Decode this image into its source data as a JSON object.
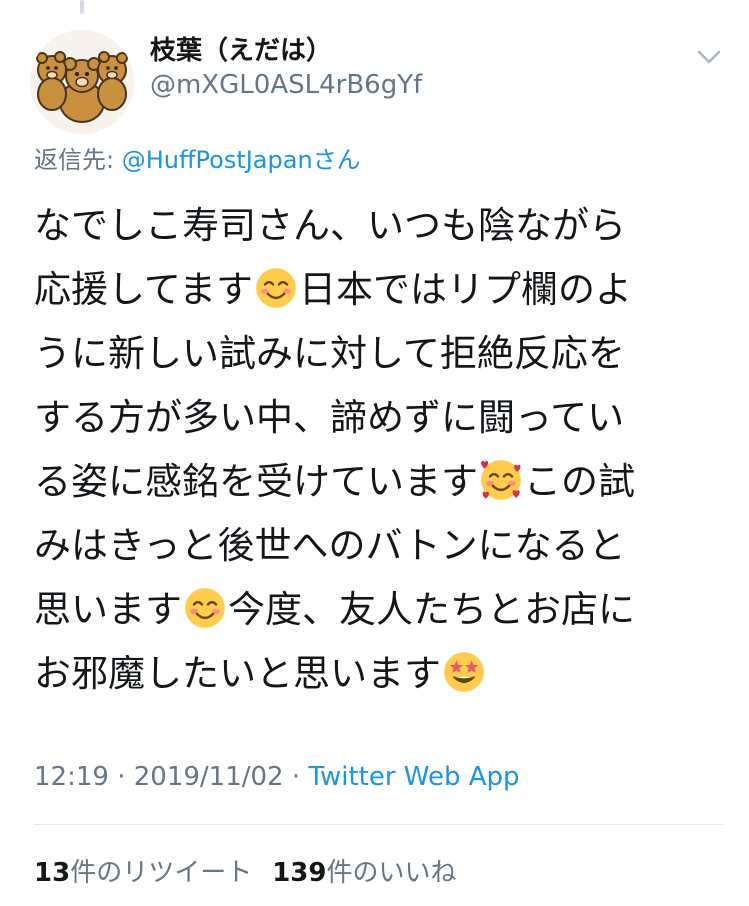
{
  "author": {
    "display_name": "枝葉（えだは）",
    "handle": "@mXGL0ASL4rB6gYf",
    "avatar_icon": "teddy-bears-avatar"
  },
  "reply": {
    "prefix": "返信先: ",
    "mention": "@HuffPostJapan",
    "suffix": "さん"
  },
  "tweet": {
    "lines": [
      [
        "なでしこ寿司さん、いつも陰ながら"
      ],
      [
        "応援してます",
        "smiling-face-icon",
        "日本ではリプ欄のよ"
      ],
      [
        "うに新しい試みに対して拒絶反応を"
      ],
      [
        "する方が多い中、諦めずに闘ってい"
      ],
      [
        "る姿に感銘を受けています",
        "smiling-face-with-hearts-icon",
        "この試"
      ],
      [
        "みはきっと後世へのバトンになると"
      ],
      [
        "思います",
        "smiling-face-icon",
        "今度、友人たちとお店に"
      ],
      [
        "お邪魔したいと思います",
        "star-struck-icon"
      ]
    ]
  },
  "meta": {
    "time": "12:19",
    "sep1": " · ",
    "date": "2019/11/02",
    "sep2": " · ",
    "app": "Twitter Web App"
  },
  "stats": {
    "retweet_count": "13",
    "retweet_label": "件のリツイート",
    "like_count": "139",
    "like_label": "件のいいね"
  },
  "icons": {
    "chevron": "chevron-down-icon"
  },
  "colors": {
    "accent": "#1b95e0",
    "muted": "#657786",
    "text": "#14171a",
    "divider": "#e1e8ed"
  }
}
